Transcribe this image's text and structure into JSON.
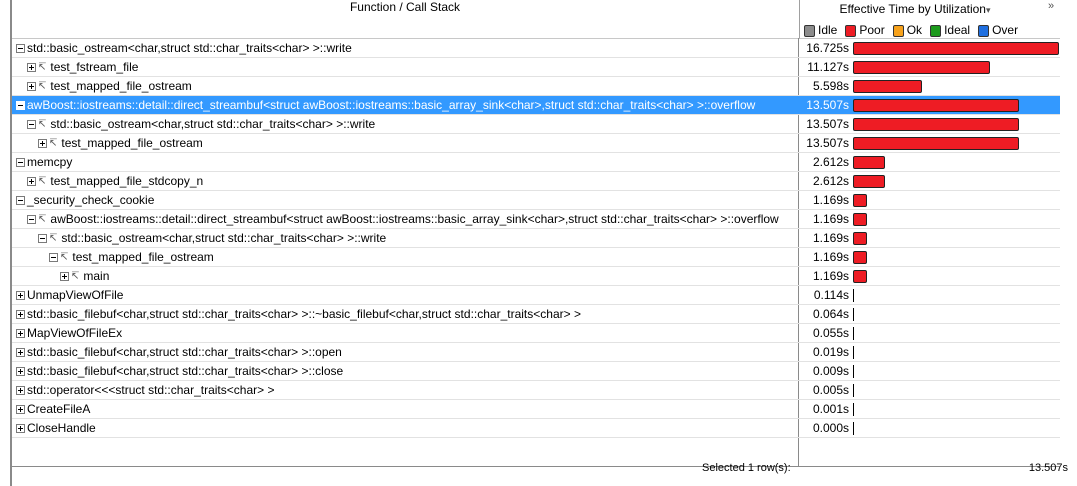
{
  "header": {
    "function_col": "Function / Call Stack",
    "time_col": "Effective Time by Utilization",
    "sort_arrow": "▾",
    "corner_glyph": "»",
    "legend": [
      {
        "label": "Idle",
        "color": "#8c8c8c"
      },
      {
        "label": "Poor",
        "color": "#ee1c24"
      },
      {
        "label": "Ok",
        "color": "#f7a21b"
      },
      {
        "label": "Ideal",
        "color": "#1c9a1c"
      },
      {
        "label": "Over",
        "color": "#1f6fe0"
      }
    ]
  },
  "rows": [
    {
      "name": "std::basic_ostream<char,struct std::char_traits<char> >::write",
      "time": "16.725s",
      "seconds": 16.725,
      "depth": 0,
      "expander": "minus",
      "callee": false,
      "selected": false
    },
    {
      "name": "test_fstream_file",
      "time": "11.127s",
      "seconds": 11.127,
      "depth": 1,
      "expander": "plus",
      "callee": true,
      "selected": false
    },
    {
      "name": "test_mapped_file_ostream",
      "time": "5.598s",
      "seconds": 5.598,
      "depth": 1,
      "expander": "plus",
      "callee": true,
      "selected": false
    },
    {
      "name": "awBoost::iostreams::detail::direct_streambuf<struct awBoost::iostreams::basic_array_sink<char>,struct std::char_traits<char> >::overflow",
      "time": "13.507s",
      "seconds": 13.507,
      "depth": 0,
      "expander": "minus",
      "callee": false,
      "selected": true
    },
    {
      "name": "std::basic_ostream<char,struct std::char_traits<char> >::write",
      "time": "13.507s",
      "seconds": 13.507,
      "depth": 1,
      "expander": "minus",
      "callee": true,
      "selected": false
    },
    {
      "name": "test_mapped_file_ostream",
      "time": "13.507s",
      "seconds": 13.507,
      "depth": 2,
      "expander": "plus",
      "callee": true,
      "selected": false
    },
    {
      "name": "memcpy",
      "time": "2.612s",
      "seconds": 2.612,
      "depth": 0,
      "expander": "minus",
      "callee": false,
      "selected": false
    },
    {
      "name": "test_mapped_file_stdcopy_n",
      "time": "2.612s",
      "seconds": 2.612,
      "depth": 1,
      "expander": "plus",
      "callee": true,
      "selected": false
    },
    {
      "name": "_security_check_cookie",
      "time": "1.169s",
      "seconds": 1.169,
      "depth": 0,
      "expander": "minus",
      "callee": false,
      "selected": false
    },
    {
      "name": "awBoost::iostreams::detail::direct_streambuf<struct awBoost::iostreams::basic_array_sink<char>,struct std::char_traits<char> >::overflow",
      "time": "1.169s",
      "seconds": 1.169,
      "depth": 1,
      "expander": "minus",
      "callee": true,
      "selected": false
    },
    {
      "name": "std::basic_ostream<char,struct std::char_traits<char> >::write",
      "time": "1.169s",
      "seconds": 1.169,
      "depth": 2,
      "expander": "minus",
      "callee": true,
      "selected": false
    },
    {
      "name": "test_mapped_file_ostream",
      "time": "1.169s",
      "seconds": 1.169,
      "depth": 3,
      "expander": "minus",
      "callee": true,
      "selected": false
    },
    {
      "name": "main",
      "time": "1.169s",
      "seconds": 1.169,
      "depth": 4,
      "expander": "plus",
      "callee": true,
      "selected": false
    },
    {
      "name": "UnmapViewOfFile",
      "time": "0.114s",
      "seconds": 0.114,
      "depth": 0,
      "expander": "plus",
      "callee": false,
      "selected": false
    },
    {
      "name": "std::basic_filebuf<char,struct std::char_traits<char> >::~basic_filebuf<char,struct std::char_traits<char> >",
      "time": "0.064s",
      "seconds": 0.064,
      "depth": 0,
      "expander": "plus",
      "callee": false,
      "selected": false
    },
    {
      "name": "MapViewOfFileEx",
      "time": "0.055s",
      "seconds": 0.055,
      "depth": 0,
      "expander": "plus",
      "callee": false,
      "selected": false
    },
    {
      "name": "std::basic_filebuf<char,struct std::char_traits<char> >::open",
      "time": "0.019s",
      "seconds": 0.019,
      "depth": 0,
      "expander": "plus",
      "callee": false,
      "selected": false
    },
    {
      "name": "std::basic_filebuf<char,struct std::char_traits<char> >::close",
      "time": "0.009s",
      "seconds": 0.009,
      "depth": 0,
      "expander": "plus",
      "callee": false,
      "selected": false
    },
    {
      "name": "std::operator<<<struct std::char_traits<char> >",
      "time": "0.005s",
      "seconds": 0.005,
      "depth": 0,
      "expander": "plus",
      "callee": false,
      "selected": false
    },
    {
      "name": "CreateFileA",
      "time": "0.001s",
      "seconds": 0.001,
      "depth": 0,
      "expander": "plus",
      "callee": false,
      "selected": false
    },
    {
      "name": "CloseHandle",
      "time": "0.000s",
      "seconds": 0.0,
      "depth": 0,
      "expander": "plus",
      "callee": false,
      "selected": false
    }
  ],
  "footer": {
    "selected_text": "Selected 1 row(s):",
    "sum_text": "13.507s"
  }
}
